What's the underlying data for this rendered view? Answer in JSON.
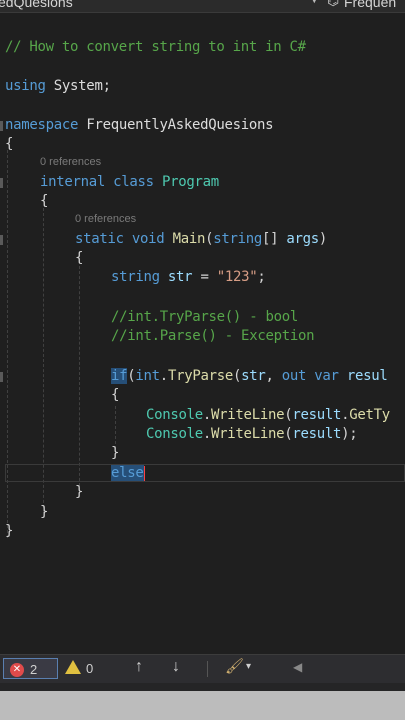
{
  "topbar": {
    "file_tab": "edQuesions",
    "dropdown_icon": "chevron-down-icon",
    "member_icon": "class-icon",
    "member_dropdown": "Frequen"
  },
  "editor": {
    "comment": "// How to convert string to int in C#",
    "using_kw": "using",
    "using_ns": "System",
    "namespace_kw": "namespace",
    "namespace_name": "FrequentlyAskedQuesions",
    "refs1": "0 references",
    "internal_kw": "internal",
    "class_kw": "class",
    "class_name": "Program",
    "refs2": "0 references",
    "static_kw": "static",
    "void_kw": "void",
    "main_name": "Main",
    "string_kw": "string",
    "args_name": "args",
    "str_name": "str",
    "str_value": "\"123\"",
    "cmt_tryparse": "//int.TryParse() - bool",
    "cmt_parse": "//int.Parse() - Exception",
    "if_kw": "if",
    "int_kw": "int",
    "tryparse_name": "TryParse",
    "out_kw": "out",
    "var_kw": "var",
    "result_name": "resul",
    "console1": "Console",
    "writeline1": "WriteLine",
    "result_ref1": "result",
    "gettype": "GetTy",
    "console2": "Console",
    "writeline2": "WriteLine",
    "result_ref2": "result",
    "else_kw": "else"
  },
  "status": {
    "error_count": "2",
    "warning_count": "0",
    "error_icon": "error-circle-icon",
    "warning_icon": "warning-triangle-icon",
    "up_icon": "arrow-up-icon",
    "down_icon": "arrow-down-icon",
    "brush_icon": "brush-icon",
    "left_icon": "triangle-left-icon"
  }
}
